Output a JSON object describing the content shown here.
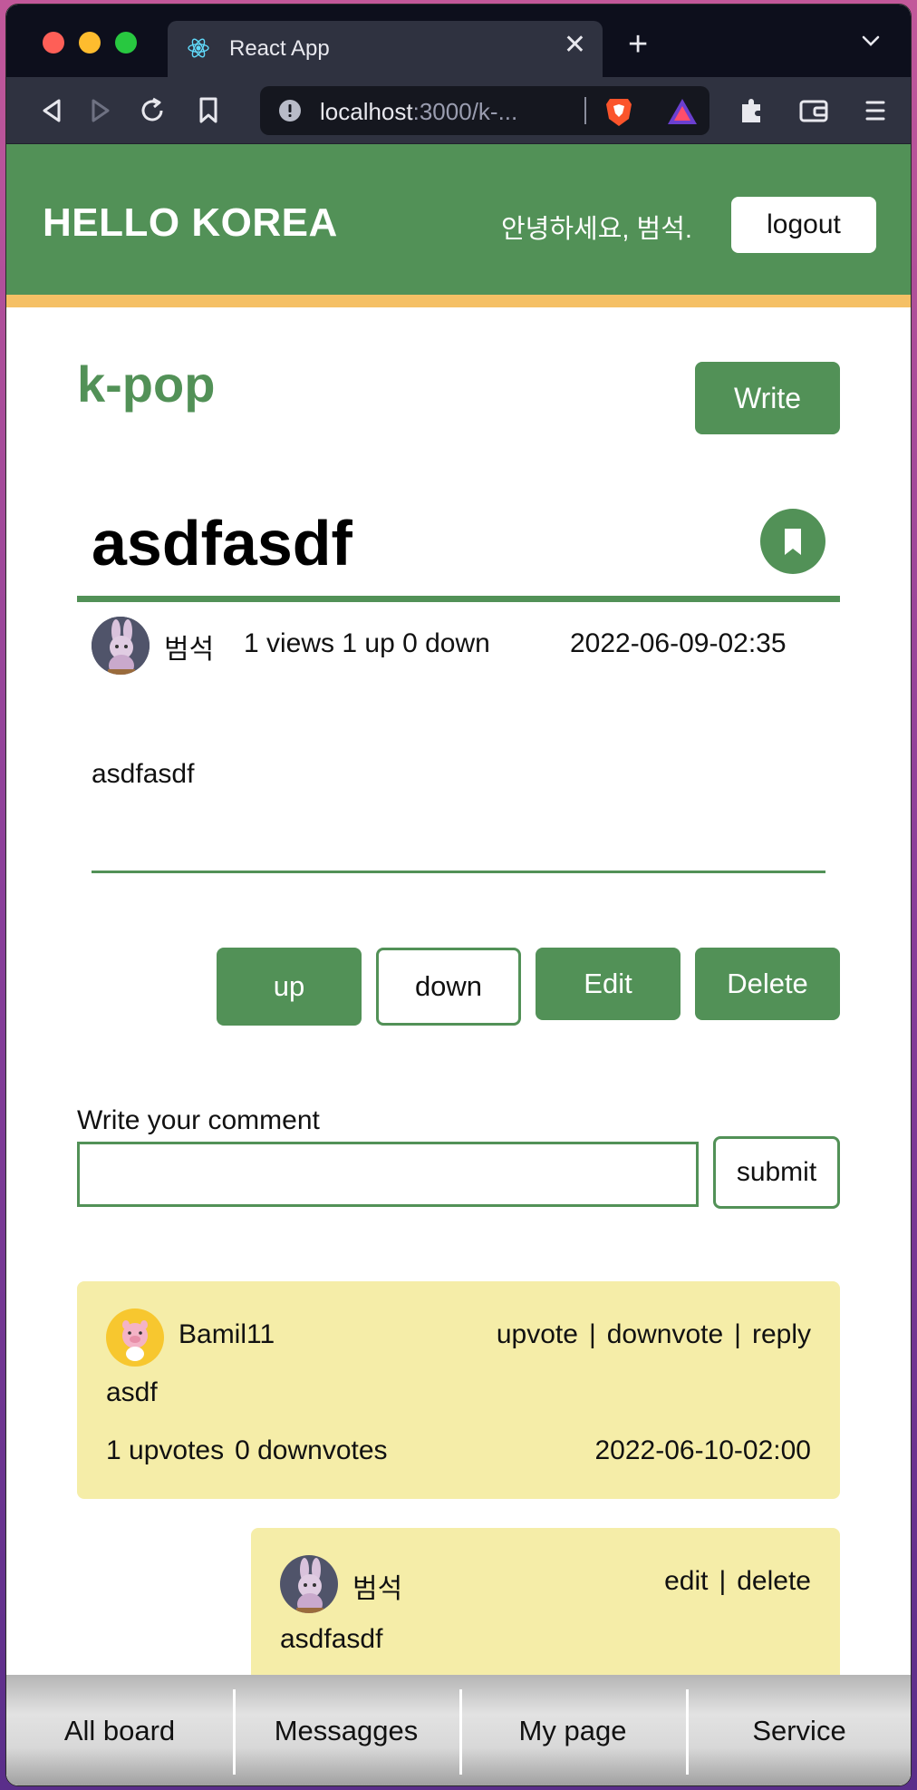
{
  "browser": {
    "tab_title": "React App",
    "url_host": "localhost",
    "url_rest": ":3000/k-..."
  },
  "header": {
    "brand": "HELLO KOREA",
    "greeting": "안녕하세요, 범석.",
    "logout_label": "logout"
  },
  "board": {
    "title": "k-pop",
    "write_label": "Write"
  },
  "post": {
    "title": "asdfasdf",
    "author": "범석",
    "stats": "1 views 1 up 0 down",
    "date": "2022-06-09-02:35",
    "body": "asdfasdf",
    "actions": {
      "up": "up",
      "down": "down",
      "edit": "Edit",
      "delete": "Delete"
    }
  },
  "comment_form": {
    "label": "Write your comment",
    "value": "",
    "submit_label": "submit"
  },
  "comments": [
    {
      "author": "Bamil11",
      "actions": [
        "upvote",
        "downvote",
        "reply"
      ],
      "separator": "|",
      "text": "asdf",
      "upvotes": "1 upvotes",
      "downvotes": "0 downvotes",
      "date": "2022-06-10-02:00"
    },
    {
      "author": "범석",
      "actions": [
        "edit",
        "delete"
      ],
      "separator": "|",
      "text": "asdfasdf"
    }
  ],
  "bottom_nav": [
    "All board",
    "Messagges",
    "My page",
    "Service"
  ],
  "colors": {
    "accent": "#529157",
    "header_stripe": "#f5c065",
    "comment_bg": "#f5eda8"
  }
}
